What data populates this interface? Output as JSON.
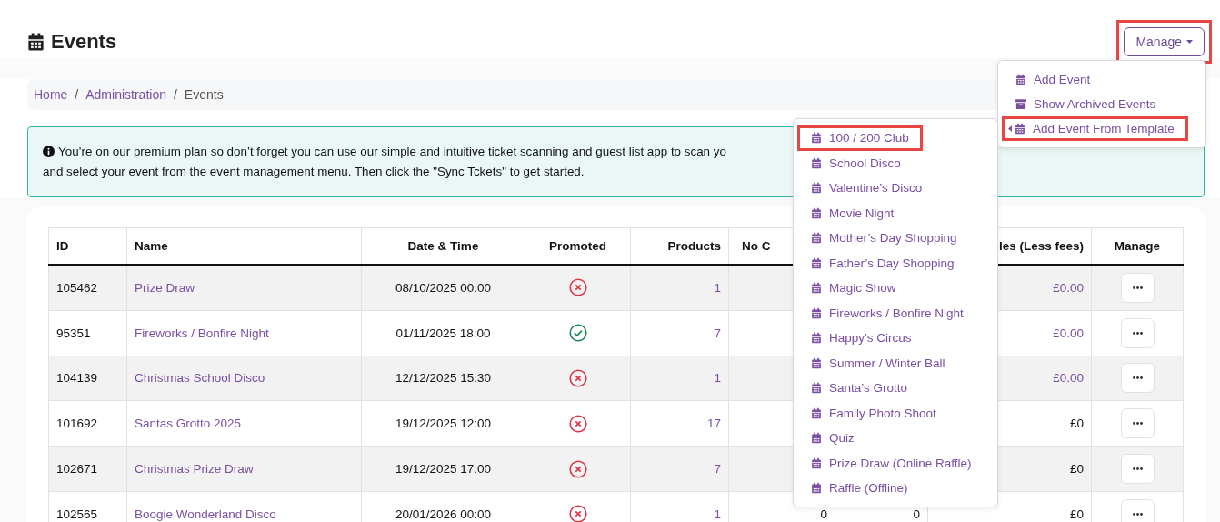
{
  "page": {
    "title": "Events"
  },
  "manage_button": {
    "label": "Manage",
    "highlighted": true
  },
  "breadcrumb": [
    {
      "label": "Home",
      "link": true,
      "separator": "/"
    },
    {
      "label": "Administration",
      "link": true,
      "separator": "/"
    },
    {
      "label": "Events",
      "link": false
    }
  ],
  "alert": {
    "lines": [
      "You’re on our premium plan so don’t forget you can use our simple and intuitive ticket scanning and guest list app to scan yo",
      "and select your event from the event management menu. Then click the \"Sync Tckets\" to get started."
    ]
  },
  "manage_menu": [
    {
      "label": "Add Event",
      "kind": "calendar",
      "submenu": false,
      "highlighted": false
    },
    {
      "label": "Show Archived Events",
      "kind": "archive",
      "submenu": false,
      "highlighted": false
    },
    {
      "label": "Add Event From Template",
      "kind": "calendar",
      "submenu": true,
      "highlighted": true
    }
  ],
  "template_menu": [
    {
      "label": "100 / 200 Club",
      "highlighted": true
    },
    {
      "label": "School Disco",
      "highlighted": false
    },
    {
      "label": "Valentine’s Disco",
      "highlighted": false
    },
    {
      "label": "Movie Night",
      "highlighted": false
    },
    {
      "label": "Mother’s Day Shopping",
      "highlighted": false
    },
    {
      "label": "Father’s Day Shopping",
      "highlighted": false
    },
    {
      "label": "Magic Show",
      "highlighted": false
    },
    {
      "label": "Fireworks / Bonfire Night",
      "highlighted": false
    },
    {
      "label": "Happy’s Circus",
      "highlighted": false
    },
    {
      "label": "Summer / Winter Ball",
      "highlighted": false
    },
    {
      "label": "Santa’s Grotto",
      "highlighted": false
    },
    {
      "label": "Family Photo Shoot",
      "highlighted": false
    },
    {
      "label": "Quiz",
      "highlighted": false
    },
    {
      "label": "Prize Draw (Online Raffle)",
      "highlighted": false
    },
    {
      "label": "Raffle (Offline)",
      "highlighted": false
    }
  ],
  "table": {
    "columns": [
      "ID",
      "Name",
      "Date & Time",
      "Promoted",
      "Products",
      "No C",
      "",
      "les (Less fees)",
      "Manage"
    ],
    "rows": [
      {
        "id": "105462",
        "name": "Prize Draw",
        "datetime": "08/10/2025 00:00",
        "promoted": false,
        "products": "1",
        "sales": "£0.00",
        "sales_link": true
      },
      {
        "id": "95351",
        "name": "Fireworks / Bonfire Night",
        "datetime": "01/11/2025 18:00",
        "promoted": true,
        "products": "7",
        "sales": "£0.00",
        "sales_link": true
      },
      {
        "id": "104139",
        "name": "Christmas School Disco",
        "datetime": "12/12/2025 15:30",
        "promoted": false,
        "products": "1",
        "sales": "£0.00",
        "sales_link": true
      },
      {
        "id": "101692",
        "name": "Santas Grotto 2025",
        "datetime": "19/12/2025 12:00",
        "promoted": false,
        "products": "17",
        "sales": "£0",
        "sales_link": false
      },
      {
        "id": "102671",
        "name": "Christmas Prize Draw",
        "datetime": "19/12/2025 17:00",
        "promoted": false,
        "products": "7",
        "sales": "£0",
        "sales_link": false
      },
      {
        "id": "102565",
        "name": "Boogie Wonderland Disco",
        "datetime": "20/01/2026 00:00",
        "promoted": false,
        "products": "1",
        "column_6": "0",
        "column_7": "0",
        "sales": "£0",
        "sales_link": false
      }
    ]
  }
}
